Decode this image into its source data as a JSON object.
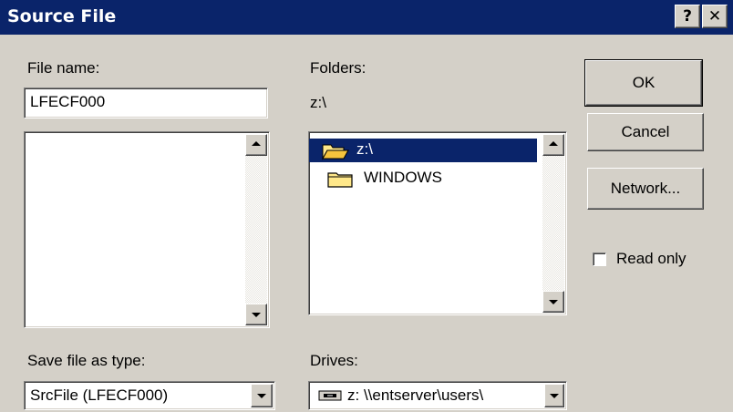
{
  "window": {
    "title": "Source File",
    "help_label": "?",
    "close_label": "✕"
  },
  "file_name": {
    "label": "File name:",
    "value": "LFECF000"
  },
  "folders": {
    "label": "Folders:",
    "current_path": "z:\\",
    "items": [
      {
        "name": "z:\\",
        "icon": "open-folder-icon",
        "selected": true
      },
      {
        "name": "WINDOWS",
        "icon": "folder-icon",
        "selected": false
      }
    ]
  },
  "buttons": {
    "ok": "OK",
    "cancel": "Cancel",
    "network": "Network..."
  },
  "read_only": {
    "label": "Read only",
    "checked": false
  },
  "save_type": {
    "label": "Save file as type:",
    "value": "SrcFile (LFECF000)"
  },
  "drives": {
    "label": "Drives:",
    "value": "z: \\\\entserver\\users\\"
  },
  "colors": {
    "titlebar": "#0a246a",
    "selection": "#0a246a",
    "face": "#d4d0c8"
  }
}
